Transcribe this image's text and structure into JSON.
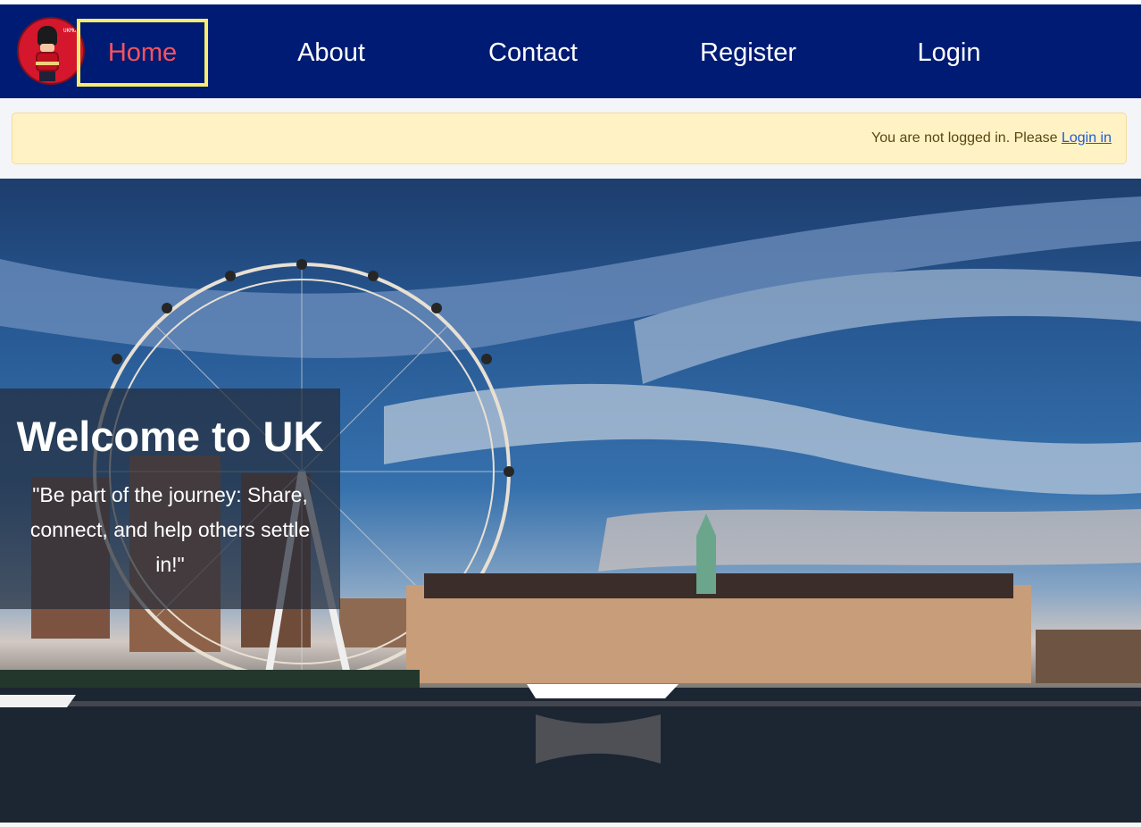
{
  "brand": {
    "logo_text": "UKMOVE"
  },
  "nav": {
    "items": [
      {
        "label": "Home",
        "active": true
      },
      {
        "label": "About"
      },
      {
        "label": "Contact"
      },
      {
        "label": "Register"
      },
      {
        "label": "Login"
      }
    ]
  },
  "alert": {
    "message": "You are not logged in. Please ",
    "link": "Login in"
  },
  "hero": {
    "title": "Welcome to UK",
    "subtitle": "\"Be part of the journey: Share, connect, and help others settle in!\""
  },
  "colors": {
    "nav_background": "#001b73",
    "active_link": "#f6535d",
    "active_outline": "#f7ec6d",
    "alert_background": "#fff2c5",
    "link": "#1f58d6"
  }
}
